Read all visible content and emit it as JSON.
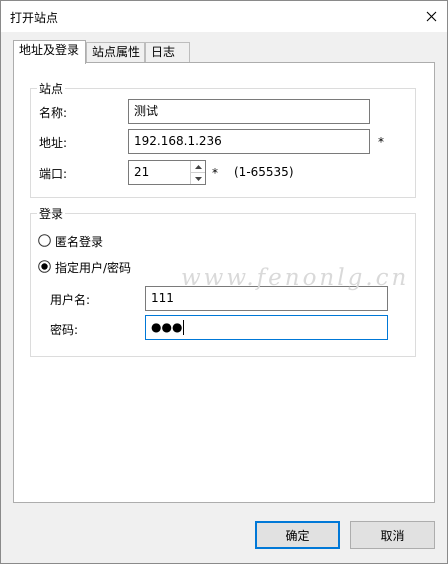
{
  "window": {
    "title": "打开站点",
    "close_glyph": "✕"
  },
  "tabs": [
    {
      "label": "地址及登录",
      "active": true
    },
    {
      "label": "站点属性",
      "active": false
    },
    {
      "label": "日志",
      "active": false
    }
  ],
  "site_group": {
    "legend": "站点",
    "name_label": "名称:",
    "name_value": "测试",
    "address_label": "地址:",
    "address_value": "192.168.1.236",
    "address_required": "*",
    "port_label": "端口:",
    "port_value": "21",
    "port_required": "*",
    "port_range": "(1-65535)"
  },
  "login_group": {
    "legend": "登录",
    "anonymous_label": "匿名登录",
    "anonymous_selected": false,
    "specified_label": "指定用户/密码",
    "specified_selected": true,
    "username_label": "用户名:",
    "username_value": "111",
    "password_label": "密码:",
    "password_value": "●●●"
  },
  "watermark": "www.fenonlg.cn",
  "buttons": {
    "ok": "确定",
    "cancel": "取消"
  },
  "icons": {
    "close": "close-icon",
    "spin_up": "spin-up-icon",
    "spin_down": "spin-down-icon",
    "radio_off": "radio-unchecked-icon",
    "radio_on": "radio-checked-icon"
  }
}
